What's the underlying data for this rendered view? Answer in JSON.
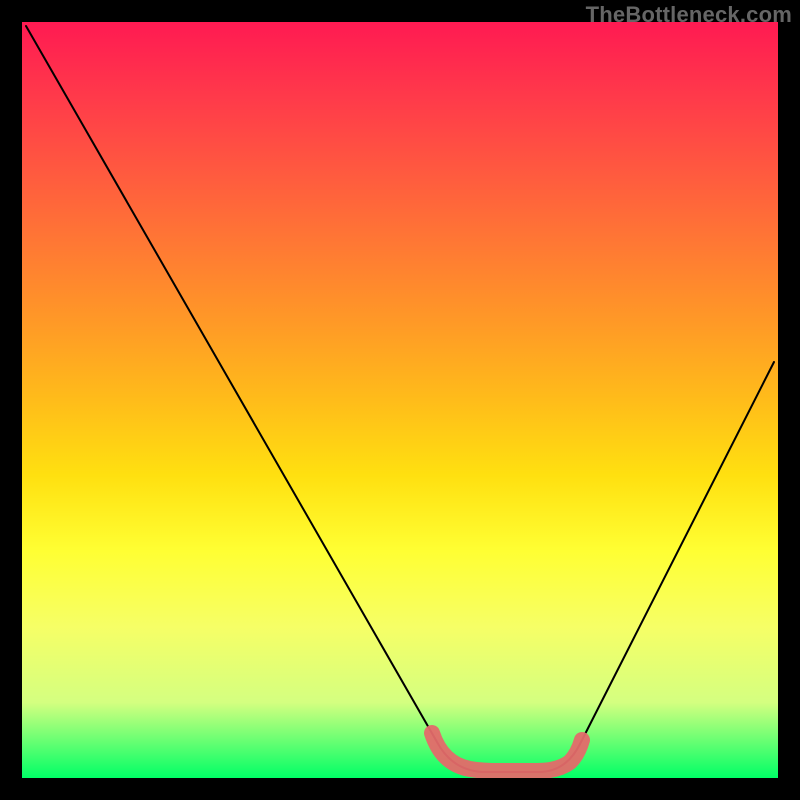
{
  "watermark": "TheBottleneck.com",
  "chart_data": {
    "type": "line",
    "title": "",
    "xlabel": "",
    "ylabel": "",
    "xlim": [
      0,
      100
    ],
    "ylim": [
      0,
      100
    ],
    "x": [
      0,
      5,
      10,
      15,
      20,
      25,
      30,
      35,
      40,
      45,
      50,
      55,
      60,
      62,
      64,
      66,
      68,
      70,
      72,
      75,
      80,
      85,
      90,
      95,
      100
    ],
    "values": [
      100,
      91,
      82,
      73,
      64,
      55,
      46,
      37,
      29,
      20,
      12,
      6,
      2,
      1,
      0.5,
      0.5,
      0.5,
      1,
      2,
      5,
      12,
      22,
      33,
      44,
      56
    ],
    "highlight_x": [
      55,
      75
    ],
    "background_gradient": [
      "#ff1a52",
      "#ff5a3f",
      "#ff9a26",
      "#ffe010",
      "#ffff33",
      "#d4ff80",
      "#00ff66"
    ]
  }
}
